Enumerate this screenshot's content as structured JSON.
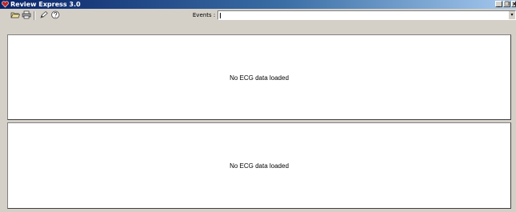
{
  "window": {
    "title": "Review Express 3.0",
    "controls": {
      "minimize": "_",
      "restore": "❐",
      "close": "×"
    }
  },
  "toolbar": {
    "buttons": [
      {
        "name": "open-icon"
      },
      {
        "name": "print-icon"
      },
      {
        "name": "edit-icon"
      },
      {
        "name": "help-icon"
      }
    ],
    "events_label": "Events :",
    "events_value": ""
  },
  "panels": [
    {
      "message": "No ECG data loaded"
    },
    {
      "message": "No ECG data loaded"
    }
  ],
  "colors": {
    "titlebar_start": "#0a246a",
    "titlebar_end": "#a6caf0",
    "chrome": "#d4d0c8",
    "app_icon": "#c0282b"
  }
}
